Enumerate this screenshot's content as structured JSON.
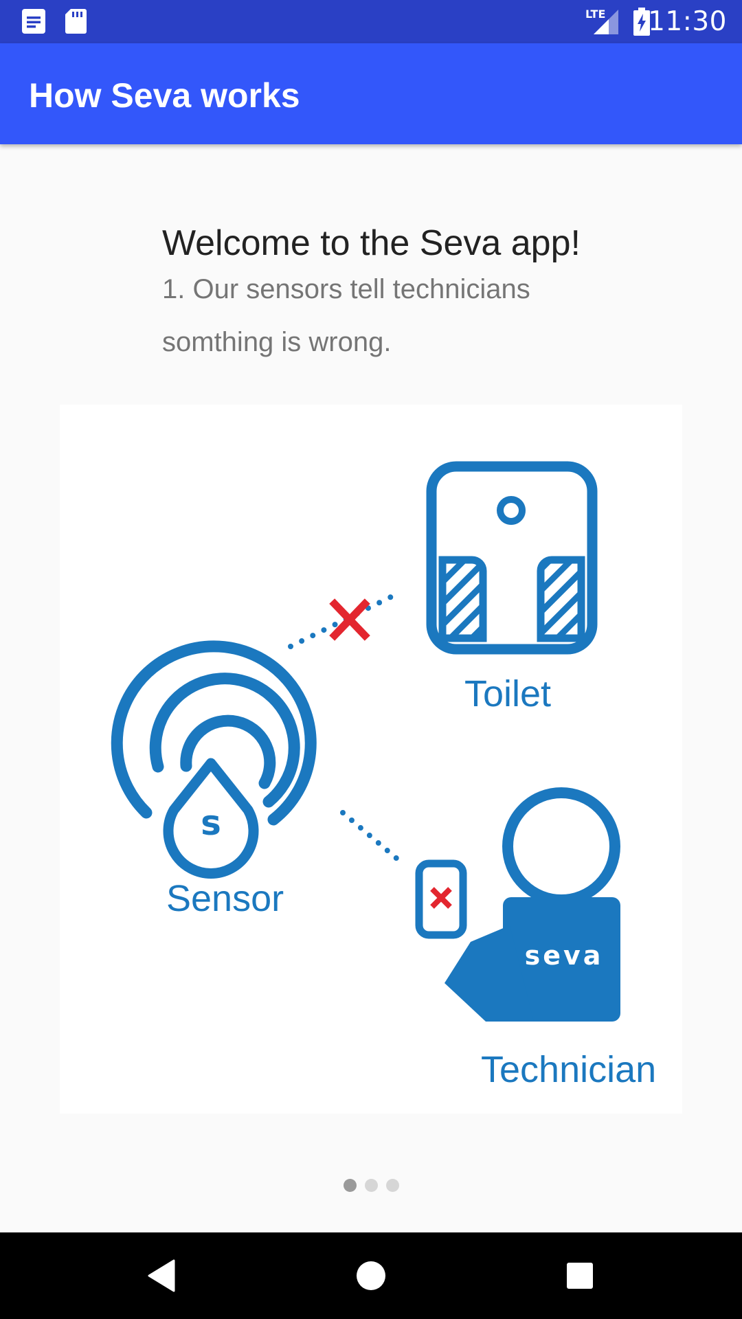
{
  "status_bar": {
    "time": "11:30",
    "network": "LTE",
    "icons": [
      "notification-doc-icon",
      "sd-card-icon",
      "lte-signal-icon",
      "battery-charging-icon"
    ]
  },
  "app_bar": {
    "title": "How Seva works"
  },
  "onboarding": {
    "title": "Welcome to the Seva app!",
    "description": "1. Our sensors tell technicians somthing is wrong.",
    "illustration": {
      "labels": {
        "toilet": "Toilet",
        "sensor": "Sensor",
        "technician": "Technician"
      },
      "sensor_letter": "s",
      "shirt_text": "seva",
      "colors": {
        "blue": "#1b78bf",
        "red": "#e3262f"
      }
    },
    "pager": {
      "pages": 3,
      "current": 1
    }
  },
  "nav_bar": {
    "buttons": [
      "back",
      "home",
      "recents"
    ]
  },
  "colors": {
    "status_bar": "#2a40c5",
    "app_bar": "#3357fa",
    "background": "#fafafa"
  }
}
